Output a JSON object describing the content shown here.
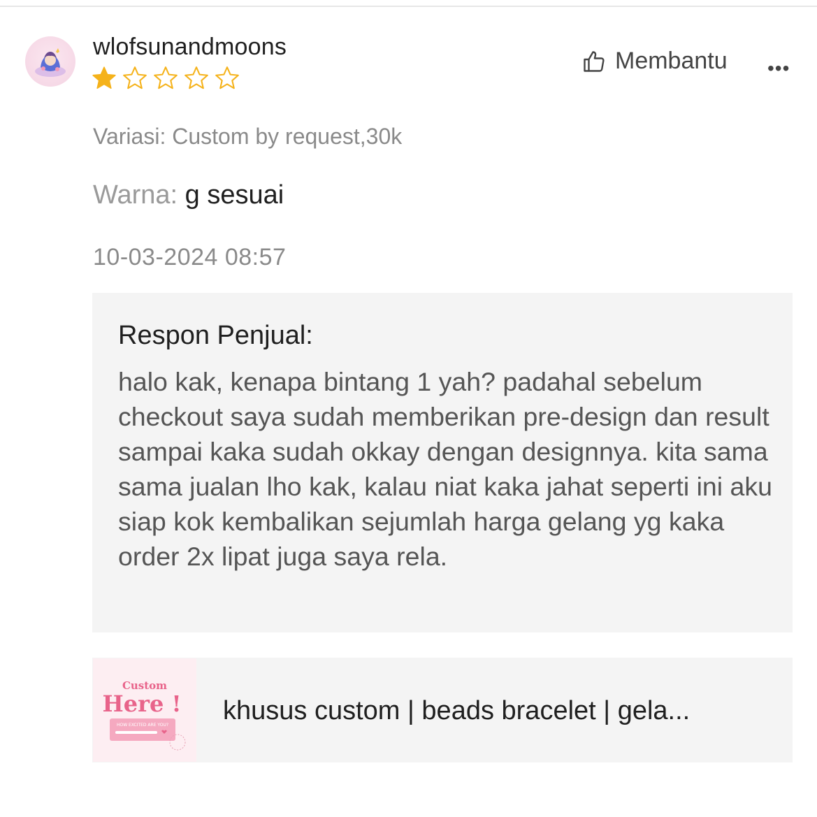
{
  "review": {
    "username": "wlofsunandmoons",
    "rating": 1,
    "rating_max": 5,
    "helpful_label": "Membantu",
    "more_label": "•••",
    "variation": "Variasi: Custom by request,30k",
    "color_label": "Warna:",
    "color_value": "g sesuai",
    "timestamp": "10-03-2024 08:57"
  },
  "seller_response": {
    "title": "Respon Penjual:",
    "body": "halo kak, kenapa bintang 1 yah? padahal sebelum checkout saya sudah memberikan pre-design dan result sampai kaka sudah okkay dengan designnya. kita sama sama jualan lho kak, kalau niat kaka jahat seperti ini aku siap kok kembalikan sejumlah harga gelang yg kaka order 2x lipat juga saya rela."
  },
  "product": {
    "name": "khusus custom | beads bracelet | gela...",
    "thumb_text_small": "Custom",
    "thumb_text_large": "Here !",
    "thumb_caption": "HOW EXCITED ARE YOU?"
  },
  "colors": {
    "star_filled": "#f5b21a",
    "star_empty": "#f5b21a",
    "response_bg": "#f4f4f4",
    "thumb_pink": "#e8638a"
  },
  "icons": {
    "helpful": "thumbs-up-icon",
    "more": "more-dots-icon",
    "star": "star-icon"
  }
}
